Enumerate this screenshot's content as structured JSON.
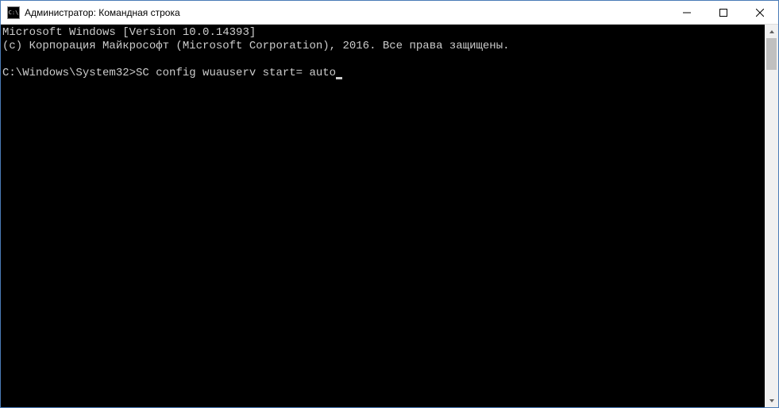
{
  "titlebar": {
    "icon_label": "C:\\",
    "title": "Администратор: Командная строка"
  },
  "window_controls": {
    "minimize": "minimize",
    "maximize": "maximize",
    "close": "close"
  },
  "terminal": {
    "line1": "Microsoft Windows [Version 10.0.14393]",
    "line2": "(c) Корпорация Майкрософт (Microsoft Corporation), 2016. Все права защищены.",
    "blank": "",
    "prompt": "C:\\Windows\\System32>",
    "command": "SC config wuauserv start= auto"
  }
}
